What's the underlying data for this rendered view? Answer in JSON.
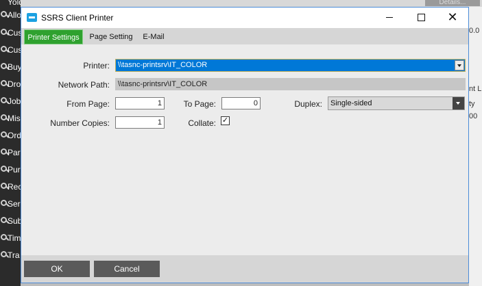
{
  "background": {
    "sidebar_items": [
      "Allo",
      "Cus",
      "Cus",
      "Buy",
      "Dro",
      "Job",
      "Mis",
      "Ord",
      "Par",
      "Pur",
      "Rec",
      "Ser",
      "Sub",
      "Tim",
      "Tra"
    ],
    "top_text": "Yold Pat",
    "details_button": "Details...",
    "right_cells": [
      "0.0",
      "nt L",
      "ty",
      "00"
    ]
  },
  "dialog": {
    "title": "SSRS Client Printer",
    "window_buttons": {
      "minimize": "—",
      "close": "✕"
    }
  },
  "tabs": [
    {
      "label": "Printer Settings",
      "active": true
    },
    {
      "label": "Page Setting",
      "active": false
    },
    {
      "label": "E-Mail",
      "active": false
    }
  ],
  "form": {
    "printer_label": "Printer:",
    "printer_value": "\\\\tasnc-printsrv\\IT_COLOR",
    "network_path_label": "Network Path:",
    "network_path_value": "\\\\tasnc-printsrv\\IT_COLOR",
    "from_page_label": "From Page:",
    "from_page_value": "1",
    "to_page_label": "To Page:",
    "to_page_value": "0",
    "duplex_label": "Duplex:",
    "duplex_value": "Single-sided",
    "copies_label": "Number Copies:",
    "copies_value": "1",
    "collate_label": "Collate:",
    "collate_checked": true,
    "checkmark": "✓"
  },
  "footer": {
    "ok_label": "OK",
    "cancel_label": "Cancel"
  },
  "colors": {
    "active_tab": "#2fa12f",
    "selection": "#0078d7",
    "app_icon": "#1ba1e2"
  }
}
